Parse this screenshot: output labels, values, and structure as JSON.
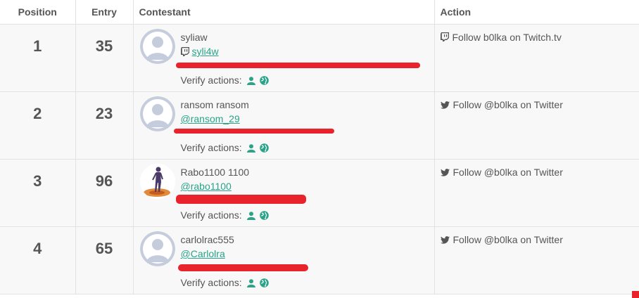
{
  "header": {
    "position": "Position",
    "entry": "Entry",
    "contestant": "Contestant",
    "action": "Action"
  },
  "colors": {
    "accent": "#2aa389",
    "redaction": "#e8232b",
    "avatar_placeholder": "#c5ccdc"
  },
  "rows": [
    {
      "position": "1",
      "entry": "35",
      "name": "syliaw",
      "handle": "syli4w",
      "handle_icon": "twitch-icon",
      "verify_label": "Verify actions:",
      "action_icon": "twitch-icon",
      "action": "Follow b0lka on Twitch.tv",
      "avatar": "placeholder"
    },
    {
      "position": "2",
      "entry": "23",
      "name": "ransom ransom",
      "handle": "@ransom_29",
      "handle_icon": "",
      "verify_label": "Verify actions:",
      "action_icon": "twitter-icon",
      "action": "Follow @b0lka on Twitter",
      "avatar": "placeholder"
    },
    {
      "position": "3",
      "entry": "96",
      "name": "Rabo1100 1100",
      "handle": "@rabo1100",
      "handle_icon": "",
      "verify_label": "Verify actions:",
      "action_icon": "twitter-icon",
      "action": "Follow @b0lka on Twitter",
      "avatar": "figure-photo"
    },
    {
      "position": "4",
      "entry": "65",
      "name": "carlolrac555",
      "handle": "@Carlolra",
      "handle_icon": "",
      "verify_label": "Verify actions:",
      "action_icon": "twitter-icon",
      "action": "Follow @b0lka on Twitter",
      "avatar": "placeholder"
    }
  ]
}
